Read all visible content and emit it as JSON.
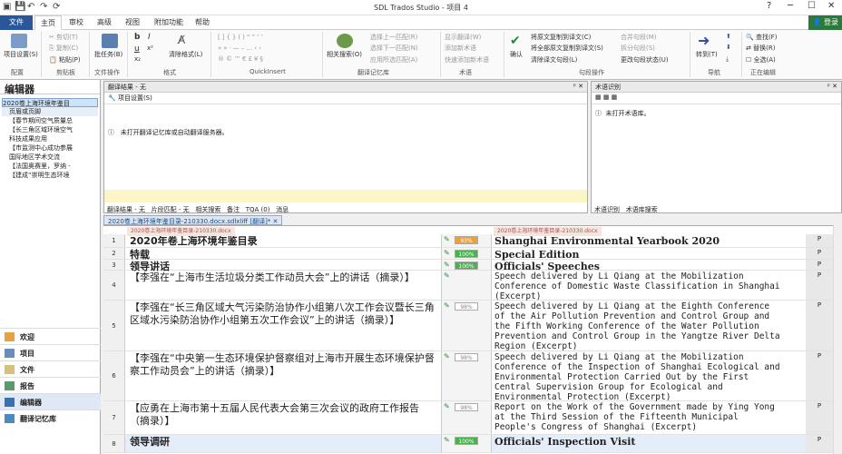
{
  "window": {
    "title": "SDL Trados Studio - 项目 4",
    "login": "登录"
  },
  "menu": [
    "文件",
    "主页",
    "审校",
    "高级",
    "视图",
    "附加功能",
    "帮助"
  ],
  "ribbon": {
    "project_settings": "项目设置(S)",
    "cut": "剪切(T)",
    "copy": "复制(C)",
    "paste": "粘贴(P)",
    "batch": "批任务(B)",
    "clear_format": "清除格式(L)",
    "related_search": "相关搜索(O)",
    "prev_match": "选择上一匹配(R)",
    "next_match": "选择下一匹配(N)",
    "apply_match": "应用所选匹配(A)",
    "show_trans": "显示翻译(W)",
    "add_term": "添加新术语",
    "quick_add": "快速添加新术语",
    "confirm": "确认",
    "copy_src": "将原文复制到译文(C)",
    "copy_all": "将全部原文复制到译文(S)",
    "clear_target": "清除译文句段(L)",
    "merge": "合并句段(M)",
    "split": "拆分句段(S)",
    "change_status": "更改句段状态(U)",
    "goto": "转到(T)",
    "find": "查找(F)",
    "replace": "替换(R)",
    "select_all": "全选(A)",
    "groups": [
      "配置",
      "剪贴板",
      "文件操作",
      "格式",
      "QuickInsert",
      "翻译记忆库",
      "术语",
      "句段操作",
      "导航",
      "正在编辑"
    ]
  },
  "left": {
    "title": "编辑器",
    "tree": [
      "2020卷上海环境年鉴目",
      "页眉或页脚",
      "【春节期间空气质量总",
      "【长三角区域环境空气",
      "科技成果应用",
      "【市监测中心成功参展",
      "国际地区学术交流",
      "【法国奥赛里，罗纳 -",
      "【建成“崇明生态环境"
    ],
    "nav": [
      "欢迎",
      "项目",
      "文件",
      "报告",
      "编辑器",
      "翻译记忆库"
    ]
  },
  "tm_pane": {
    "title": "翻译结果 - 无",
    "settings": "项目设置(S)",
    "message": "未打开翻译记忆库或自动翻译服务器。",
    "tabs": [
      "翻译结果 - 无",
      "片段匹配 - 无",
      "相关搜索",
      "备注",
      "TQA (0)",
      "消息"
    ]
  },
  "term_pane": {
    "title": "术语识别",
    "message": "未打开术语库。",
    "tabs": [
      "术语识别",
      "术语库搜索"
    ]
  },
  "doc_tab": "2020卷上海环境年鉴目录-210330.docx.sdlxliff [翻译]*",
  "col_headers": {
    "source": "2020卷上海环境年鉴目录-210330.docx",
    "target": "2020卷上海环境年鉴目录-210330.docx"
  },
  "segments": [
    {
      "n": "1",
      "src": "2020年卷上海环境年鉴目录",
      "pct": "93%",
      "tgt": "Shanghai Environmental Yearbook 2020",
      "bold": true,
      "p": "P"
    },
    {
      "n": "2",
      "src": "特载",
      "pct": "100%",
      "tgt": "Special Edition",
      "bold": true,
      "p": "P"
    },
    {
      "n": "3",
      "src": "领导讲话",
      "pct": "100%",
      "tgt": "Officials' Speeches",
      "bold": true,
      "p": "P"
    },
    {
      "n": "4",
      "src": "【李强在“上海市生活垃圾分类工作动员大会”上的讲话（摘录）】",
      "pct": "",
      "tgt": "Speech delivered by Li Qiang at the Mobilization\nConference of Domestic Waste Classification in Shanghai\n(Excerpt)",
      "bold": false,
      "p": "P"
    },
    {
      "n": "5",
      "src": "【李强在“长三角区域大气污染防治协作小组第八次工作会议暨长三角区域水污染防治协作小组第五次工作会议”上的讲话（摘录）】",
      "pct": "98%",
      "tgt": "Speech delivered by Li Qiang at the Eighth Conference\nof the Air Pollution Prevention and Control Group and\nthe Fifth Working Conference of the Water Pollution\nPrevention and Control Group in the Yangtze River Delta\nRegion (Excerpt)",
      "bold": false,
      "p": "P"
    },
    {
      "n": "6",
      "src": "【李强在“中央第一生态环境保护督察组对上海市开展生态环境保护督察工作动员会”上的讲话（摘录）】",
      "pct": "98%",
      "tgt": "Speech delivered by Li Qiang at the Mobilization\nConference of the Inspection of Shanghai Ecological and\nEnvironmental Protection Carried Out by the First\nCentral Supervision Group for Ecological and\nEnvironmental Protection (Excerpt)",
      "bold": false,
      "p": "P"
    },
    {
      "n": "7",
      "src": "【应勇在上海市第十五届人民代表大会第三次会议的政府工作报告（摘录）】",
      "pct": "98%",
      "tgt": "Report on the Work of the Government made by Ying Yong\nat the Third Session of the Fifteenth Municipal\nPeople's Congress of Shanghai (Excerpt)",
      "bold": false,
      "p": "P"
    },
    {
      "n": "8",
      "src": "领导调研",
      "pct": "100%",
      "tgt": "Officials' Inspection Visit",
      "bold": true,
      "p": "P"
    }
  ],
  "colors": {
    "accent": "#2b579a",
    "match_orange": "#f0a030",
    "match_green": "#4caf50"
  }
}
